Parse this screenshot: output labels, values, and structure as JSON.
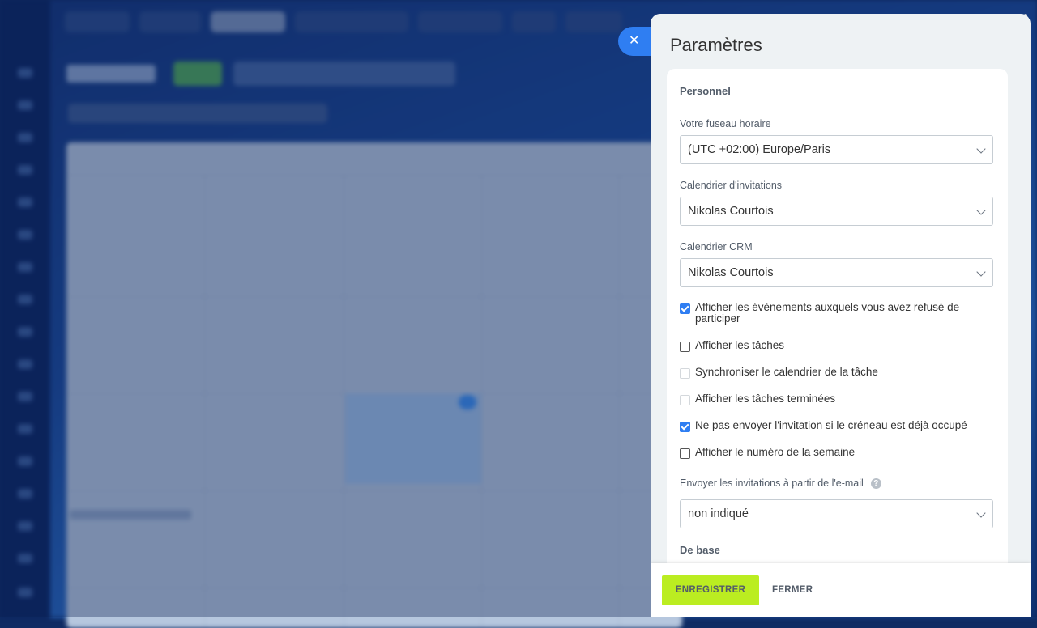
{
  "panel": {
    "title": "Paramètres",
    "close_icon": "close-icon"
  },
  "personal": {
    "section_title": "Personnel",
    "timezone": {
      "label": "Votre fuseau horaire",
      "value": "(UTC +02:00) Europe/Paris"
    },
    "invite_calendar": {
      "label": "Calendrier d'invitations",
      "value": "Nikolas Courtois"
    },
    "crm_calendar": {
      "label": "Calendrier CRM",
      "value": "Nikolas Courtois"
    },
    "checkboxes": [
      {
        "label": "Afficher les évènements auxquels vous avez refusé de participer",
        "checked": true,
        "disabled": false
      },
      {
        "label": "Afficher les tâches",
        "checked": false,
        "disabled": false
      },
      {
        "label": "Synchroniser le calendrier de la tâche",
        "checked": false,
        "disabled": true
      },
      {
        "label": "Afficher les tâches terminées",
        "checked": false,
        "disabled": true
      },
      {
        "label": "Ne pas envoyer l'invitation si le créneau est déjà occupé",
        "checked": true,
        "disabled": false
      },
      {
        "label": "Afficher le numéro de la semaine",
        "checked": false,
        "disabled": false
      }
    ],
    "sender_email": {
      "label": "Envoyer les invitations à partir de l'e-mail",
      "help_icon": "?",
      "value": "non indiqué"
    }
  },
  "basic": {
    "section_title": "De base"
  },
  "footer": {
    "save_label": "ENREGISTRER",
    "close_label": "FERMER"
  },
  "colors": {
    "accent": "#2f7ef2",
    "save_button": "#bbed21",
    "panel_bg": "#eef2f4"
  }
}
